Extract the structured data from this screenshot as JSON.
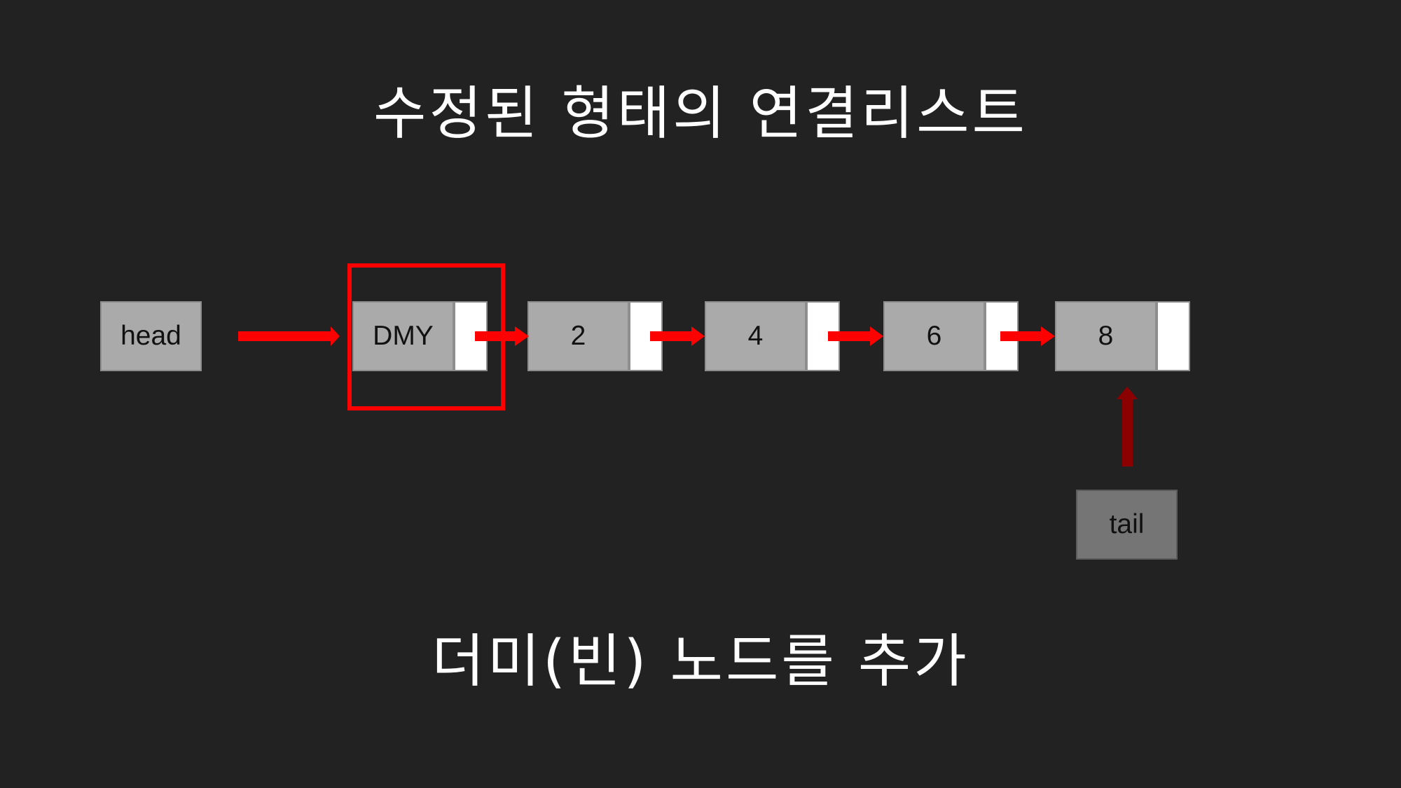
{
  "title": "수정된 형태의 연결리스트",
  "subtitle": "더미(빈) 노드를 추가",
  "head_label": "head",
  "tail_label": "tail",
  "nodes": [
    {
      "value": "DMY"
    },
    {
      "value": "2"
    },
    {
      "value": "4"
    },
    {
      "value": "6"
    },
    {
      "value": "8"
    }
  ],
  "colors": {
    "background": "#222222",
    "node": "#aaaaaa",
    "pointer_cell": "#ffffff",
    "tail_node": "#757575",
    "arrow": "#ff0000",
    "tail_arrow": "#8b0000",
    "highlight": "#ff0000"
  }
}
